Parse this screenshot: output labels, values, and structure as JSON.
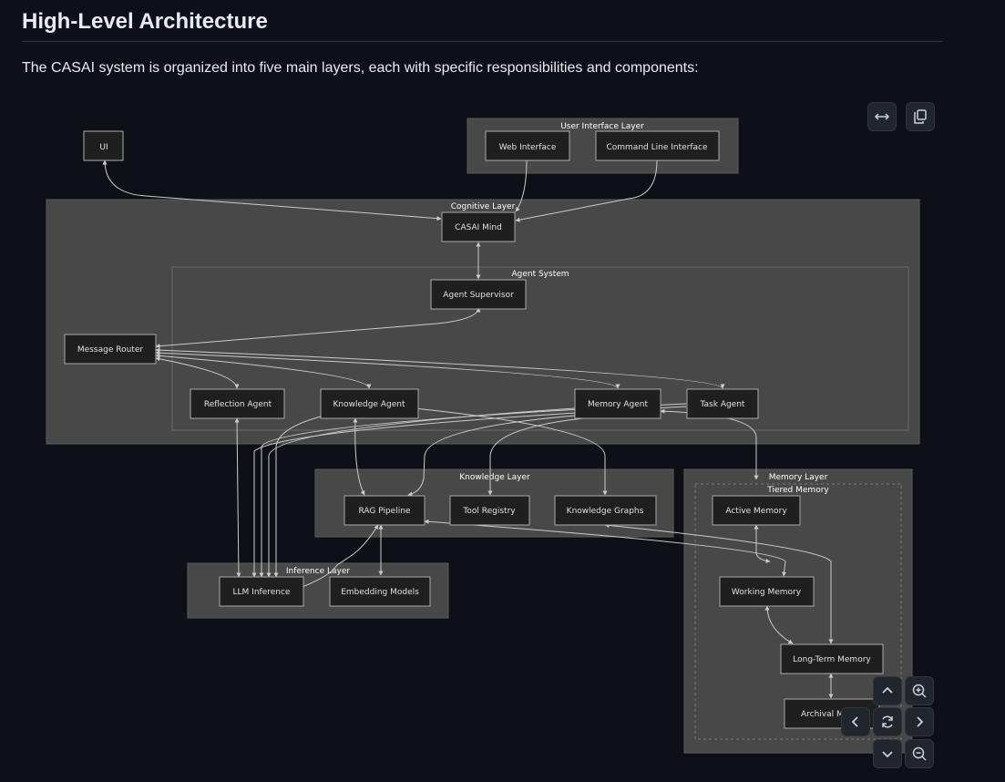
{
  "heading": "High-Level Architecture",
  "intro": "The CASAI system is organized into five main layers, each with specific responsibilities and components:",
  "groups": {
    "ui_layer": "User Interface Layer",
    "cognitive_layer": "Cognitive Layer",
    "agent_system": "Agent System",
    "knowledge_layer": "Knowledge Layer",
    "inference_layer": "Inference Layer",
    "memory_layer": "Memory Layer",
    "tiered_memory": "Tiered Memory"
  },
  "nodes": {
    "ui": "UI",
    "web_interface": "Web Interface",
    "cli": "Command Line Interface",
    "casai_mind": "CASAI Mind",
    "agent_supervisor": "Agent Supervisor",
    "message_router": "Message Router",
    "reflection_agent": "Reflection Agent",
    "knowledge_agent": "Knowledge Agent",
    "memory_agent": "Memory Agent",
    "task_agent": "Task Agent",
    "rag_pipeline": "RAG Pipeline",
    "tool_registry": "Tool Registry",
    "knowledge_graphs": "Knowledge Graphs",
    "llm_inference": "LLM Inference",
    "embedding_models": "Embedding Models",
    "active_memory": "Active Memory",
    "working_memory": "Working Memory",
    "long_term_memory": "Long-Term Memory",
    "archival_memory": "Archival Me"
  },
  "controls": {
    "expand": "expand-icon",
    "copy": "copy-icon",
    "pan_up": "chevron-up-icon",
    "pan_down": "chevron-down-icon",
    "pan_left": "chevron-left-icon",
    "pan_right": "chevron-right-icon",
    "reset": "reset-icon",
    "zoom_in": "zoom-in-icon",
    "zoom_out": "zoom-out-icon"
  },
  "colors": {
    "page_bg": "#0d1117",
    "layer_bg": "#484848",
    "node_bg": "#1f1f1f",
    "edge": "#cccccc"
  }
}
